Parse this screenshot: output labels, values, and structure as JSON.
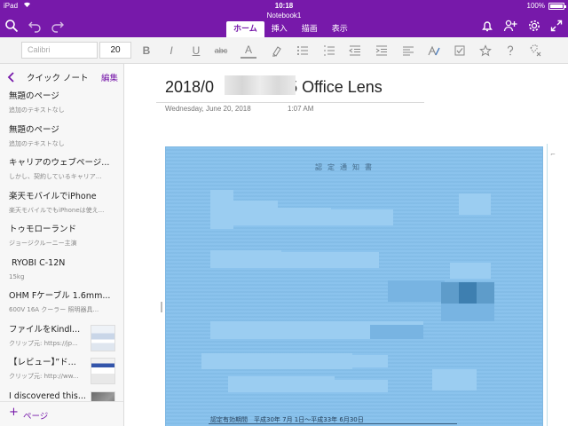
{
  "status_bar": {
    "carrier": "iPad",
    "time": "10:18",
    "battery": "100%"
  },
  "notebook_title": "Notebook1",
  "tabs": [
    {
      "label": "ホーム",
      "active": true
    },
    {
      "label": "挿入",
      "active": false
    },
    {
      "label": "描画",
      "active": false
    },
    {
      "label": "表示",
      "active": false
    }
  ],
  "ribbon": {
    "font_name_placeholder": "Calibri",
    "font_size": "20",
    "bold": "B",
    "italic": "I",
    "underline": "U",
    "strikethrough": "abc",
    "font_color": "A"
  },
  "sidebar": {
    "title": "クイック ノート",
    "edit_label": "編集",
    "add_page_label": "ページ",
    "pages": [
      {
        "title": "無題のページ",
        "subtitle": "追加のテキストなし"
      },
      {
        "title": "無題のページ",
        "subtitle": "追加のテキストなし"
      },
      {
        "title": "キャリアのウェブページ...",
        "subtitle": "しかし、契約しているキャリア..."
      },
      {
        "title": "楽天モバイルでiPhone",
        "subtitle": "楽天モバイルでもiPhoneは使え..."
      },
      {
        "title": "トゥモローランド",
        "subtitle": "ジョージクルーニー主演"
      },
      {
        "title": " RYOBI C-12N",
        "subtitle": "15kg"
      },
      {
        "title": "OHM Fケーブル 1.6mm...",
        "subtitle": "600V 16A クーラー 照明器具..."
      },
      {
        "title": "ファイルをKindl...",
        "subtitle": "クリップ元: https://jp...",
        "thumb": "thumb1"
      },
      {
        "title": "【レビュー】”ド...",
        "subtitle": "クリップ元: http://ww...",
        "thumb": "thumb2"
      },
      {
        "title": "I discovered this...",
        "subtitle": "",
        "thumb": "thumb3"
      }
    ]
  },
  "page": {
    "title_prefix": "2018/0",
    "title_suffix": "5 Office Lens",
    "date": "Wednesday, June 20, 2018",
    "time": "1:07 AM"
  },
  "scan": {
    "heading": "認定通知書",
    "footer": "認定有効期間　平成30年 7月 1日〜平成33年 6月30日"
  },
  "colors": {
    "accent": "#7719aa",
    "scan_background": "#86c1ec"
  }
}
